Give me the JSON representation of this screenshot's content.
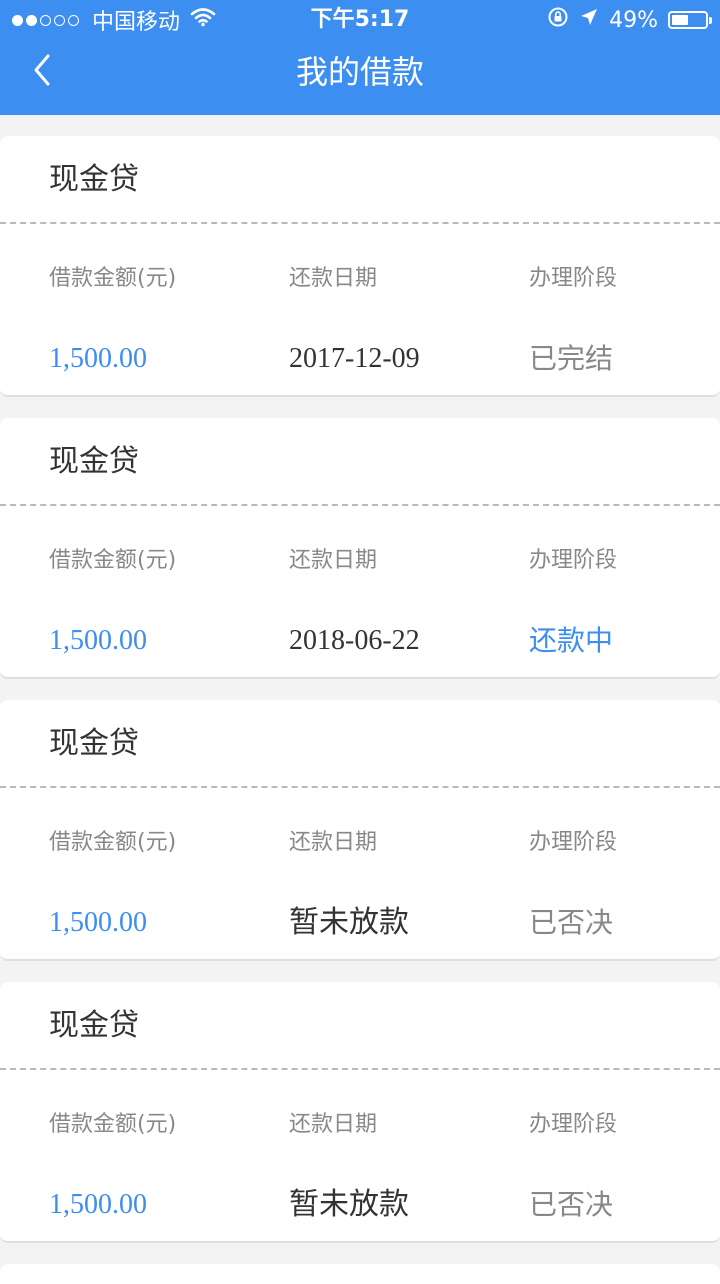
{
  "status_bar": {
    "carrier": "中国移动",
    "time": "下午5:17",
    "battery_text": "49%",
    "battery_level": 0.49,
    "icons": [
      "signal-dots",
      "wifi-icon",
      "rotation-lock-icon",
      "location-arrow-icon",
      "battery-icon"
    ]
  },
  "nav": {
    "title": "我的借款",
    "back_icon": "chevron-left-icon"
  },
  "colors": {
    "header_bg": "#3d8ef1",
    "amount": "#3d8ef1",
    "stage_active": "#3d8ef1",
    "stage_inactive": "#888888",
    "label": "#888888",
    "text": "#333333",
    "page_bg": "#f3f3f3"
  },
  "loans": [
    {
      "product": "现金贷",
      "amount_label": "借款金额(元)",
      "date_label": "还款日期",
      "stage_label": "办理阶段",
      "amount": "1,500.00",
      "date": "2017-12-09",
      "stage": "已完结"
    },
    {
      "product": "现金贷",
      "amount_label": "借款金额(元)",
      "date_label": "还款日期",
      "stage_label": "办理阶段",
      "amount": "1,500.00",
      "date": "2018-06-22",
      "stage": "还款中"
    },
    {
      "product": "现金贷",
      "amount_label": "借款金额(元)",
      "date_label": "还款日期",
      "stage_label": "办理阶段",
      "amount": "1,500.00",
      "date": "暂未放款",
      "stage": "已否决"
    },
    {
      "product": "现金贷",
      "amount_label": "借款金额(元)",
      "date_label": "还款日期",
      "stage_label": "办理阶段",
      "amount": "1,500.00",
      "date": "暂未放款",
      "stage": "已否决"
    }
  ]
}
